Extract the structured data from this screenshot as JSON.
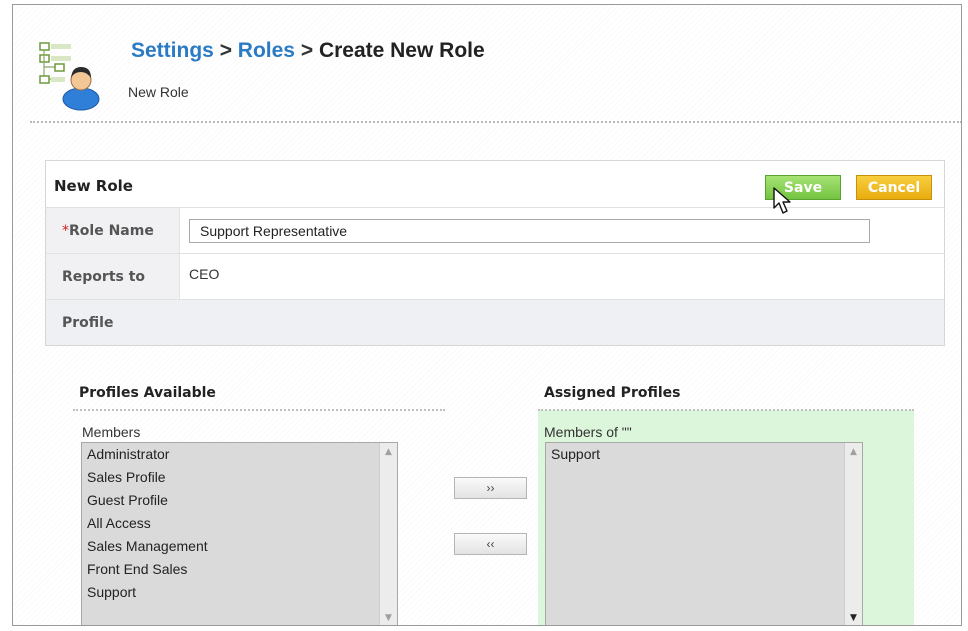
{
  "breadcrumb": {
    "settings": "Settings",
    "separator": ">",
    "roles": "Roles",
    "current": "Create New Role"
  },
  "subtitle": "New Role",
  "panel": {
    "title": "New Role",
    "save_label": "Save",
    "cancel_label": "Cancel",
    "role_name_required_mark": "*",
    "role_name_label": "Role Name",
    "role_name_value": "Support Representative",
    "reports_to_label": "Reports to",
    "reports_to_value": "CEO",
    "profile_label": "Profile"
  },
  "profiles_available": {
    "title": "Profiles Available",
    "list_label": "Members",
    "items": [
      "Administrator",
      "Sales Profile",
      "Guest Profile",
      "All Access",
      "Sales Management",
      "Front End Sales",
      "Support"
    ]
  },
  "assigned_profiles": {
    "title": "Assigned Profiles",
    "list_label": "Members of \"\"",
    "items": [
      "Support"
    ]
  },
  "buttons": {
    "add": "››",
    "remove": "‹‹"
  },
  "colors": {
    "link": "#2a7bc4",
    "save_green": "#74c342",
    "cancel_orange": "#e9ac0f",
    "assigned_bg": "#dcf6dc"
  },
  "icons": {
    "header": "role-tree-user-icon",
    "cursor": "mouse-pointer-icon"
  }
}
